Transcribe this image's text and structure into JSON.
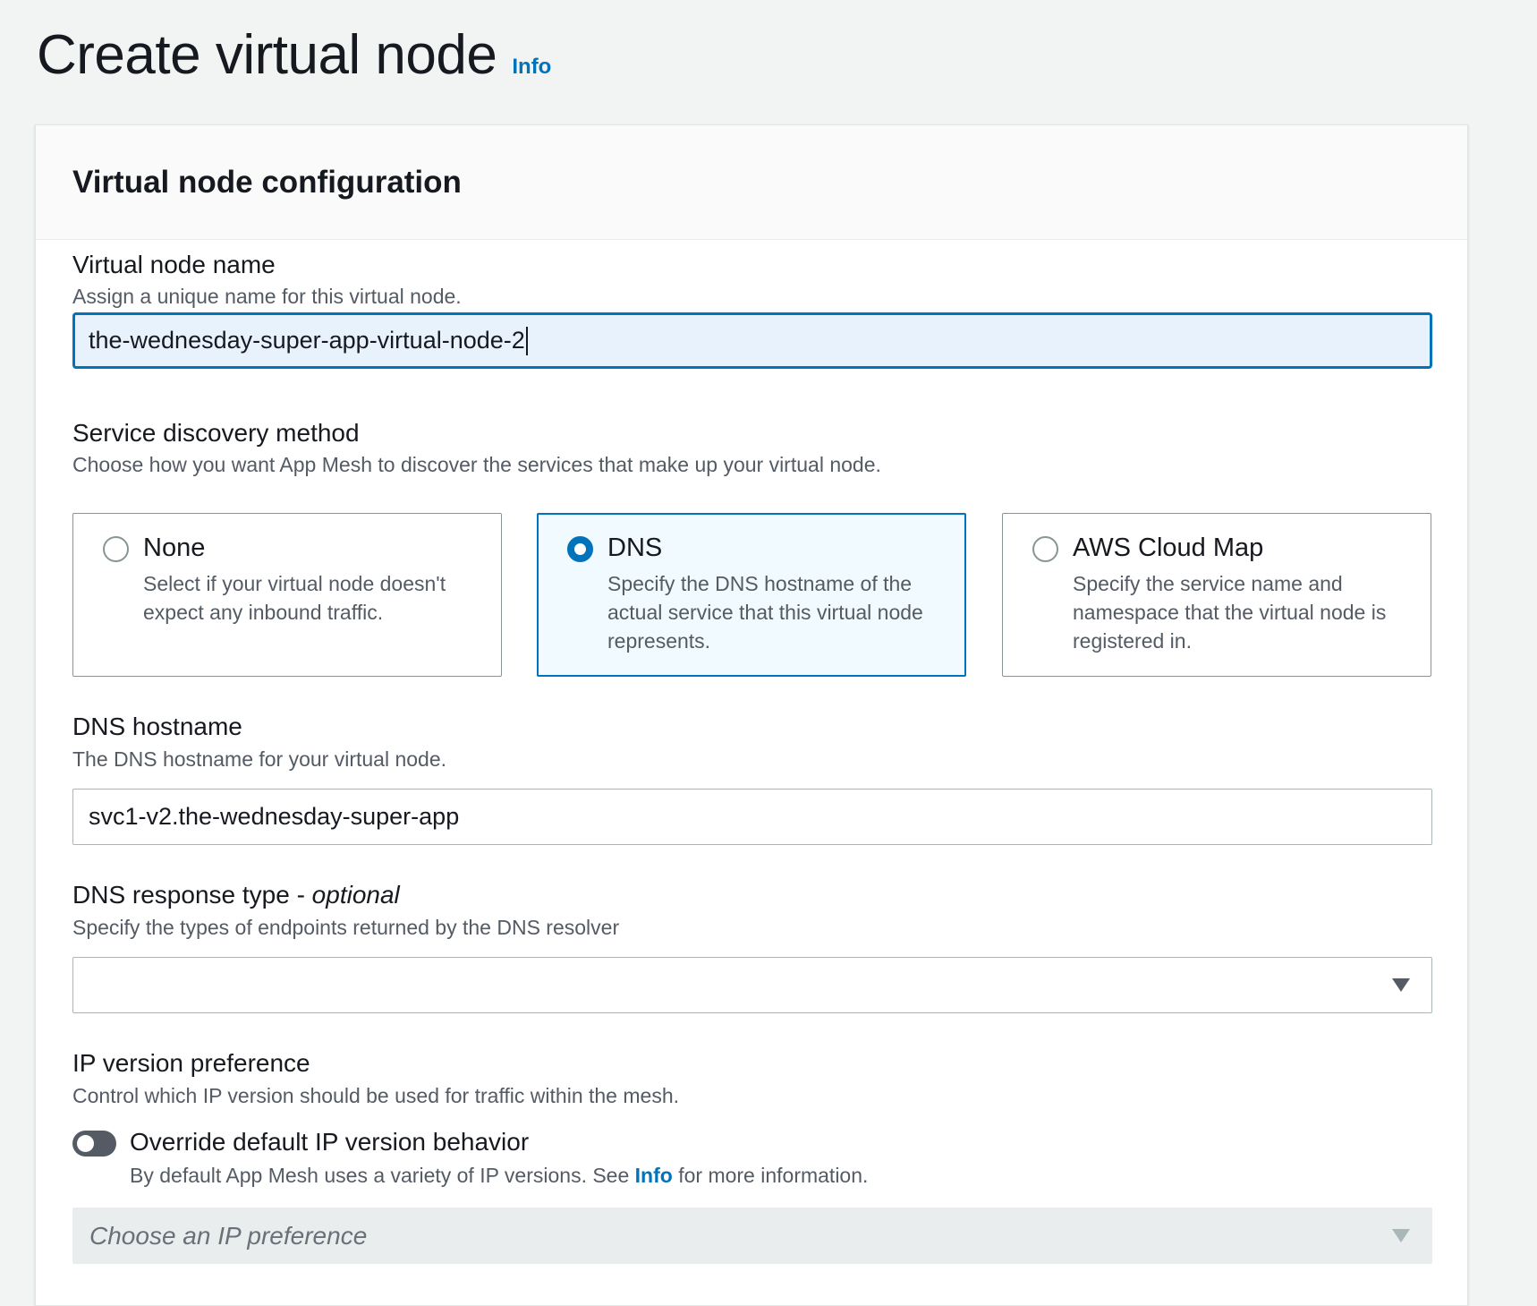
{
  "page": {
    "title": "Create virtual node",
    "info_link": "Info"
  },
  "panel": {
    "title": "Virtual node configuration"
  },
  "name_field": {
    "label": "Virtual node name",
    "description": "Assign a unique name for this virtual node.",
    "value": "the-wednesday-super-app-virtual-node-2"
  },
  "discovery": {
    "label": "Service discovery method",
    "description": "Choose how you want App Mesh to discover the services that make up your virtual node.",
    "options": [
      {
        "title": "None",
        "description": "Select if your virtual node doesn't expect any inbound traffic.",
        "selected": false
      },
      {
        "title": "DNS",
        "description": "Specify the DNS hostname of the actual service that this virtual node represents.",
        "selected": true
      },
      {
        "title": "AWS Cloud Map",
        "description": "Specify the service name and namespace that the virtual node is registered in.",
        "selected": false
      }
    ]
  },
  "dns_hostname": {
    "label": "DNS hostname",
    "description": "The DNS hostname for your virtual node.",
    "value": "svc1-v2.the-wednesday-super-app"
  },
  "dns_response_type": {
    "label": "DNS response type - ",
    "optional_tag": "optional",
    "description": "Specify the types of endpoints returned by the DNS resolver",
    "value": ""
  },
  "ip_version": {
    "label": "IP version preference",
    "description": "Control which IP version should be used for traffic within the mesh.",
    "toggle_label": "Override default IP version behavior",
    "toggle_on": false,
    "toggle_desc_before": "By default App Mesh uses a variety of IP versions. See ",
    "toggle_desc_link": "Info",
    "toggle_desc_after": " for more information.",
    "select_placeholder": "Choose an IP preference"
  },
  "colors": {
    "accent": "#0073bb",
    "page_background": "#f2f3f3",
    "text": "#16191f",
    "secondary_text": "#545b64"
  }
}
